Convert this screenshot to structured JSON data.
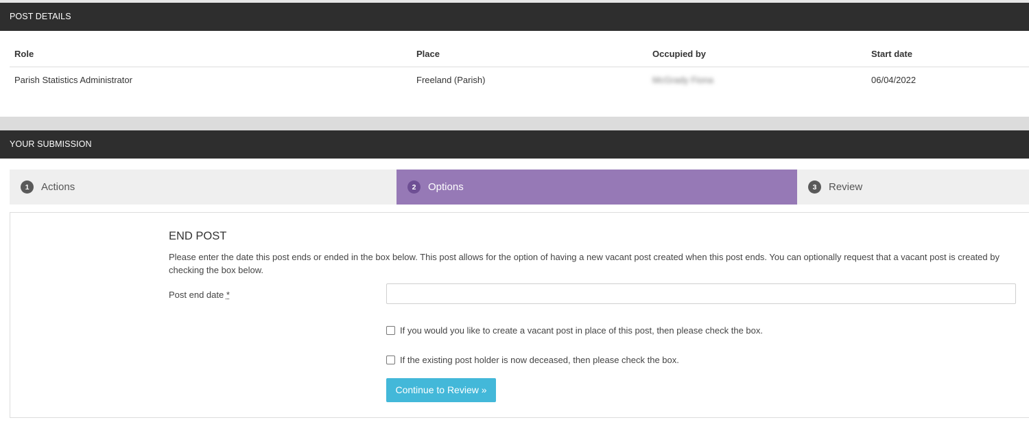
{
  "post_details": {
    "header": "POST DETAILS",
    "columns": [
      "Role",
      "Place",
      "Occupied by",
      "Start date"
    ],
    "row": {
      "role": "Parish Statistics Administrator",
      "place": "Freeland (Parish)",
      "occupied_by": "McGrady Fiona",
      "start_date": "06/04/2022"
    }
  },
  "submission": {
    "header": "YOUR SUBMISSION",
    "steps": [
      {
        "number": "1",
        "label": "Actions",
        "active": false
      },
      {
        "number": "2",
        "label": "Options",
        "active": true
      },
      {
        "number": "3",
        "label": "Review",
        "active": false
      }
    ]
  },
  "form": {
    "title": "END POST",
    "description": "Please enter the date this post ends or ended in the box below. This post allows for the option of having a new vacant post created when this post ends. You can optionally request that a vacant post is created by checking the box below.",
    "end_date_label": "Post end date",
    "required_marker": "*",
    "end_date_value": "",
    "vacant_post_checkbox": "If you would you like to create a vacant post in place of this post, then please check the box.",
    "deceased_checkbox": "If the existing post holder is now deceased, then please check the box.",
    "continue_button": "Continue to Review »"
  },
  "colors": {
    "header_bg": "#2e2e2e",
    "active_step": "#9679b6",
    "button": "#43b8d9"
  }
}
